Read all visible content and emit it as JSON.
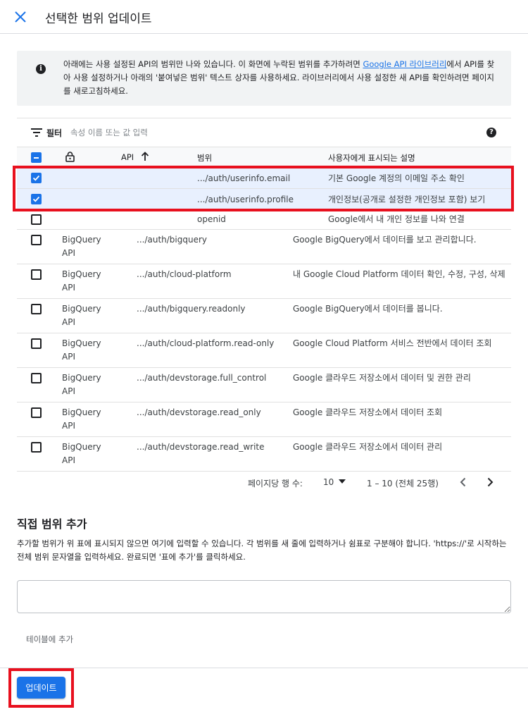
{
  "header": {
    "title": "선택한 범위 업데이트",
    "close_icon": "close-icon"
  },
  "info": {
    "text_before": "아래에는 사용 설정된 API의 범위만 나와 있습니다. 이 화면에 누락된 범위를 추가하려면 ",
    "link": "Google API 라이브러리",
    "text_after": "에서 API를 찾아 사용 설정하거나 아래의 '붙여넣은 범위' 텍스트 상자를 사용하세요. 라이브러리에서 사용 설정한 새 API를 확인하려면 페이지를 새로고침하세요."
  },
  "filter": {
    "label": "필터",
    "placeholder": "속성 이름 또는 값 입력"
  },
  "columns": {
    "api": "API",
    "scope": "범위",
    "description": "사용자에게 표시되는 설명"
  },
  "rows": [
    {
      "checked": true,
      "api": "",
      "scope": ".../auth/userinfo.email",
      "description": "기본 Google 계정의 이메일 주소 확인"
    },
    {
      "checked": true,
      "api": "",
      "scope": ".../auth/userinfo.profile",
      "description": "개인정보(공개로 설정한 개인정보 포함) 보기"
    },
    {
      "checked": false,
      "api": "",
      "scope": "openid",
      "description": "Google에서 내 개인 정보를 나와 연결"
    },
    {
      "checked": false,
      "api_line1": "BigQuery",
      "api_line2": "API",
      "scope": ".../auth/bigquery",
      "description": "Google BigQuery에서 데이터를 보고 관리합니다."
    },
    {
      "checked": false,
      "api_line1": "BigQuery",
      "api_line2": "API",
      "scope": ".../auth/cloud-platform",
      "description": "내 Google Cloud Platform 데이터 확인, 수정, 구성, 삭제"
    },
    {
      "checked": false,
      "api_line1": "BigQuery",
      "api_line2": "API",
      "scope": ".../auth/bigquery.readonly",
      "description": "Google BigQuery에서 데이터를 봅니다."
    },
    {
      "checked": false,
      "api_line1": "BigQuery",
      "api_line2": "API",
      "scope": ".../auth/cloud-platform.read-only",
      "description": "Google Cloud Platform 서비스 전반에서 데이터 조회"
    },
    {
      "checked": false,
      "api_line1": "BigQuery",
      "api_line2": "API",
      "scope": ".../auth/devstorage.full_control",
      "description": "Google 클라우드 저장소에서 데이터 및 권한 관리"
    },
    {
      "checked": false,
      "api_line1": "BigQuery",
      "api_line2": "API",
      "scope": ".../auth/devstorage.read_only",
      "description": "Google 클라우드 저장소에서 데이터 조회"
    },
    {
      "checked": false,
      "api_line1": "BigQuery",
      "api_line2": "API",
      "scope": ".../auth/devstorage.read_write",
      "description": "Google 클라우드 저장소에서 데이터 관리"
    }
  ],
  "pagination": {
    "rows_per_page_label": "페이지당 행 수:",
    "rows_per_page": "10",
    "range": "1 – 10 (전체 25행)"
  },
  "manual": {
    "title": "직접 범위 추가",
    "description": "추가할 범위가 위 표에 표시되지 않으면 여기에 입력할 수 있습니다. 각 범위를 새 줄에 입력하거나 쉼표로 구분해야 합니다. 'https://'로 시작하는 전체 범위 문자열을 입력하세요. 완료되면 '표에 추가'를 클릭하세요.",
    "textarea_value": "",
    "add_button": "테이블에 추가"
  },
  "footer": {
    "update_button": "업데이트"
  },
  "colors": {
    "accent": "#1a73e8",
    "highlight": "#e8101e",
    "selected_row": "#e8f0fe"
  }
}
